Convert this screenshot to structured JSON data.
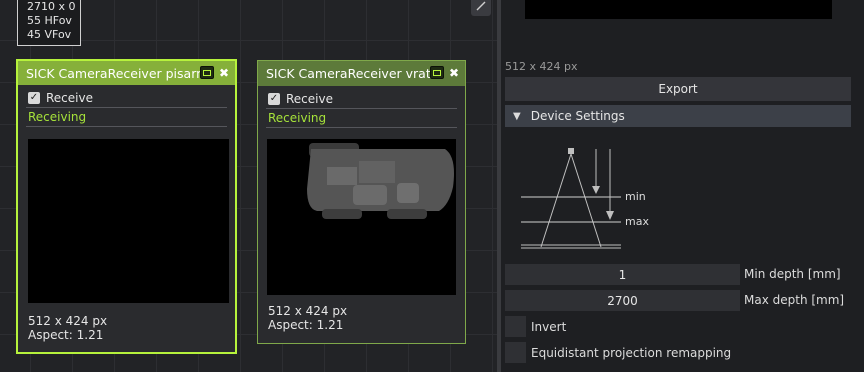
{
  "info_box": {
    "lines": [
      "2710 x 0",
      "55 HFov",
      "45 VFov"
    ]
  },
  "nodes": [
    {
      "title": "SICK CameraReceiver pisarna",
      "receive_label": "Receive",
      "status": "Receiving",
      "resolution": "512 x 424 px",
      "aspect": "Aspect: 1.21"
    },
    {
      "title": "SICK CameraReceiver vrata",
      "receive_label": "Receive",
      "status": "Receiving",
      "resolution": "512 x 424 px",
      "aspect": "Aspect: 1.21"
    }
  ],
  "panel": {
    "resolution": "512 x 424 px",
    "export_label": "Export",
    "section_title": "Device Settings",
    "diagram": {
      "min_label": "min",
      "max_label": "max"
    },
    "min_depth": {
      "value": "1",
      "label": "Min depth [mm]"
    },
    "max_depth": {
      "value": "2700",
      "label": "Max depth [mm]"
    },
    "invert_label": "Invert",
    "equidistant_label": "Equidistant projection remapping"
  },
  "colors": {
    "accent": "#b6f23c",
    "status": "#a6e33a",
    "node_header_active": "#86b03a",
    "node_header": "#5d7a3a"
  }
}
